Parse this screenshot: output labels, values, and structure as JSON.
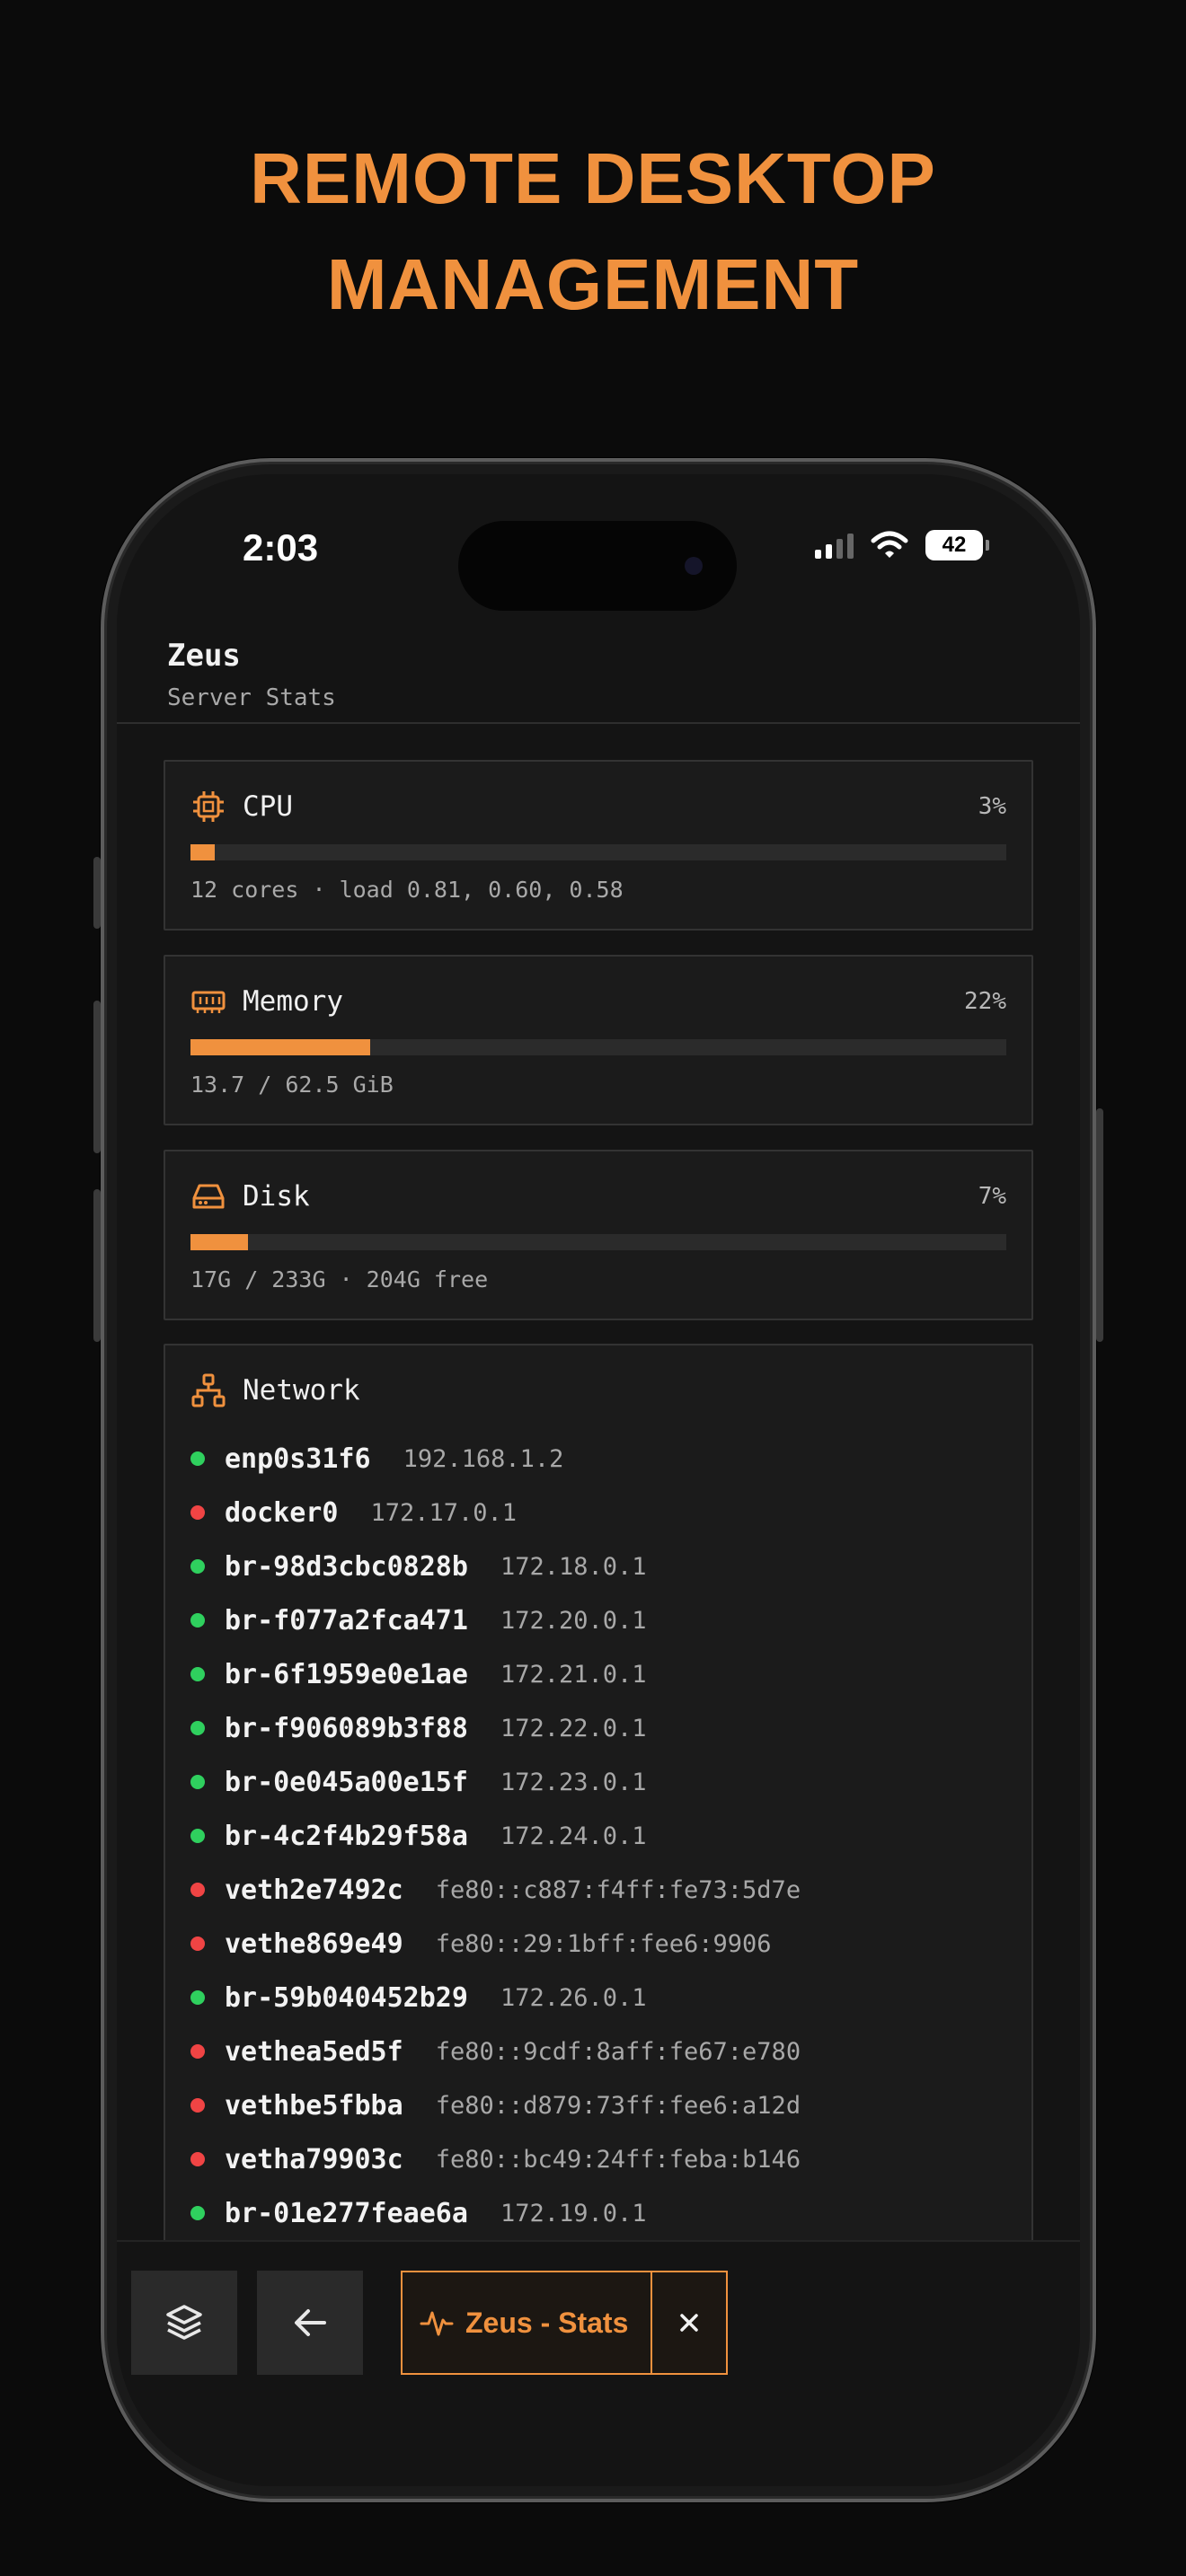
{
  "headline": {
    "line1": "REMOTE DESKTOP",
    "line2": "MANAGEMENT"
  },
  "status_bar": {
    "time": "2:03",
    "battery": "42",
    "icons": [
      "cellular-signal-icon",
      "wifi-icon",
      "battery-icon"
    ]
  },
  "header": {
    "title": "Zeus",
    "subtitle": "Server Stats"
  },
  "colors": {
    "accent": "#f0913e",
    "status_up": "#2fd05e",
    "status_down": "#f04444",
    "background": "#141414",
    "card": "#1b1b1b"
  },
  "cpu": {
    "icon": "cpu-chip-icon",
    "title": "CPU",
    "percent_label": "3%",
    "usage_fraction": 0.03,
    "detail": "12 cores · load 0.81, 0.60, 0.58"
  },
  "memory": {
    "icon": "memory-icon",
    "title": "Memory",
    "percent_label": "22%",
    "usage_fraction": 0.22,
    "detail": "13.7 / 62.5 GiB"
  },
  "disk": {
    "icon": "hard-drive-icon",
    "title": "Disk",
    "percent_label": "7%",
    "usage_fraction": 0.07,
    "detail": "17G / 233G · 204G free"
  },
  "network": {
    "icon": "network-icon",
    "title": "Network",
    "interfaces": [
      {
        "name": "enp0s31f6",
        "address": "192.168.1.2",
        "status": "up"
      },
      {
        "name": "docker0",
        "address": "172.17.0.1",
        "status": "down"
      },
      {
        "name": "br-98d3cbc0828b",
        "address": "172.18.0.1",
        "status": "up"
      },
      {
        "name": "br-f077a2fca471",
        "address": "172.20.0.1",
        "status": "up"
      },
      {
        "name": "br-6f1959e0e1ae",
        "address": "172.21.0.1",
        "status": "up"
      },
      {
        "name": "br-f906089b3f88",
        "address": "172.22.0.1",
        "status": "up"
      },
      {
        "name": "br-0e045a00e15f",
        "address": "172.23.0.1",
        "status": "up"
      },
      {
        "name": "br-4c2f4b29f58a",
        "address": "172.24.0.1",
        "status": "up"
      },
      {
        "name": "veth2e7492c",
        "address": "fe80::c887:f4ff:fe73:5d7e",
        "status": "down"
      },
      {
        "name": "vethe869e49",
        "address": "fe80::29:1bff:fee6:9906",
        "status": "down"
      },
      {
        "name": "br-59b040452b29",
        "address": "172.26.0.1",
        "status": "up"
      },
      {
        "name": "vethea5ed5f",
        "address": "fe80::9cdf:8aff:fe67:e780",
        "status": "down"
      },
      {
        "name": "vethbe5fbba",
        "address": "fe80::d879:73ff:fee6:a12d",
        "status": "down"
      },
      {
        "name": "vetha79903c",
        "address": "fe80::bc49:24ff:feba:b146",
        "status": "down"
      },
      {
        "name": "br-01e277feae6a",
        "address": "172.19.0.1",
        "status": "up"
      }
    ]
  },
  "toolbar": {
    "layers_icon": "layers-icon",
    "back_icon": "arrow-left-icon",
    "active_tab": {
      "icon": "activity-pulse-icon",
      "label": "Zeus - Stats",
      "close_icon": "close-icon"
    }
  }
}
